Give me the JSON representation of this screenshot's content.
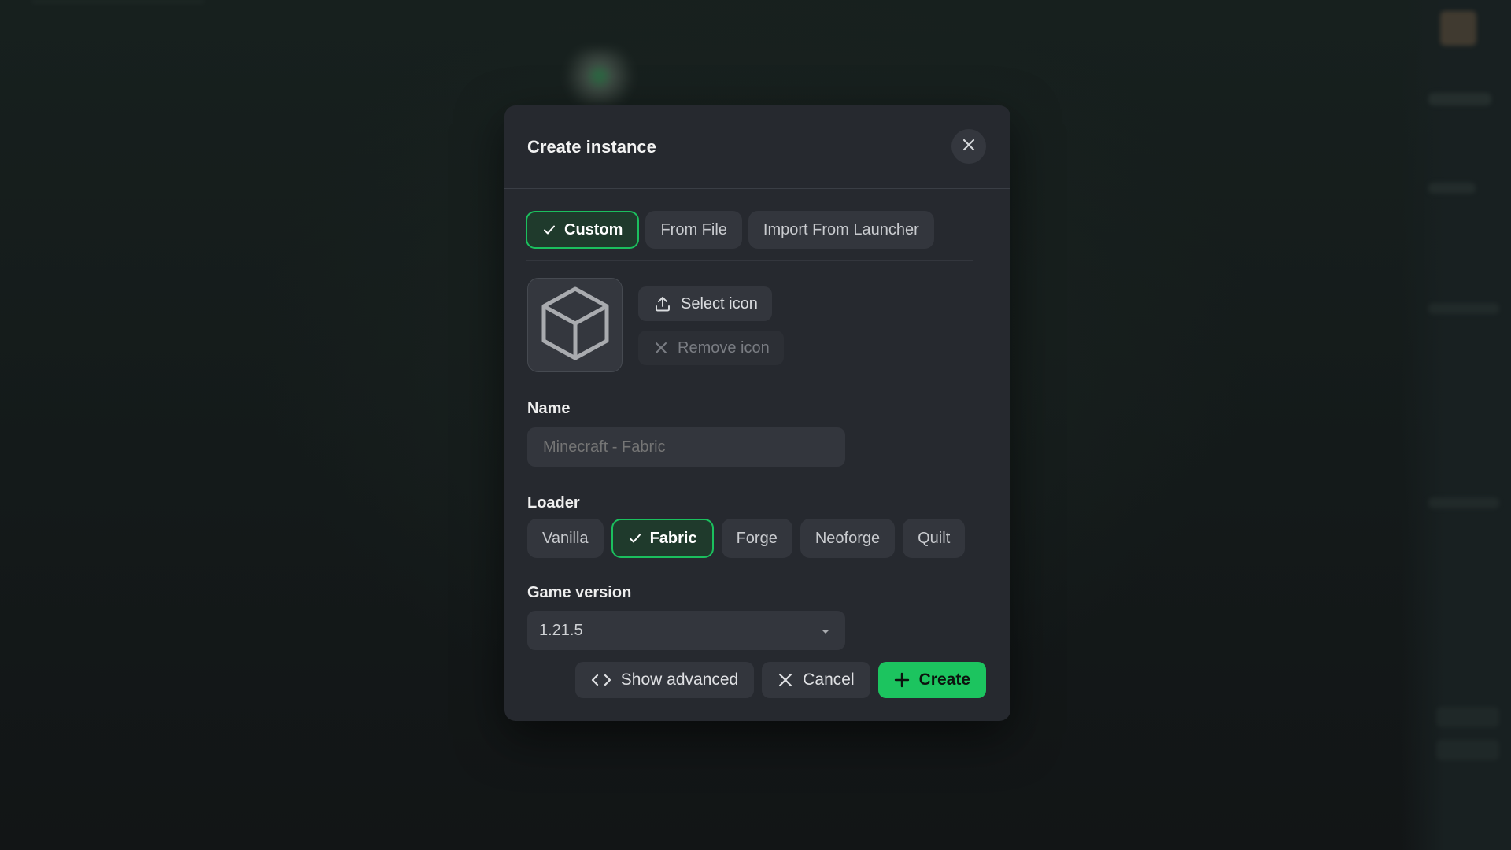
{
  "modal": {
    "title": "Create instance",
    "tabs": [
      {
        "label": "Custom",
        "active": true
      },
      {
        "label": "From File",
        "active": false
      },
      {
        "label": "Import From Launcher",
        "active": false
      }
    ],
    "icon": {
      "preview": "cube-icon",
      "select_label": "Select icon",
      "remove_label": "Remove icon"
    },
    "name_field": {
      "label": "Name",
      "value": "",
      "placeholder": "Minecraft - Fabric"
    },
    "loader": {
      "label": "Loader",
      "options": [
        {
          "label": "Vanilla",
          "active": false
        },
        {
          "label": "Fabric",
          "active": true
        },
        {
          "label": "Forge",
          "active": false
        },
        {
          "label": "Neoforge",
          "active": false
        },
        {
          "label": "Quilt",
          "active": false
        }
      ]
    },
    "game_version": {
      "label": "Game version",
      "selected": "1.21.5"
    },
    "footer": {
      "advanced_label": "Show advanced",
      "cancel_label": "Cancel",
      "create_label": "Create"
    }
  },
  "colors": {
    "accent": "#1bbf5e",
    "modal_bg": "#26292f",
    "chip_bg": "#33363d",
    "page_bg": "#121517"
  }
}
